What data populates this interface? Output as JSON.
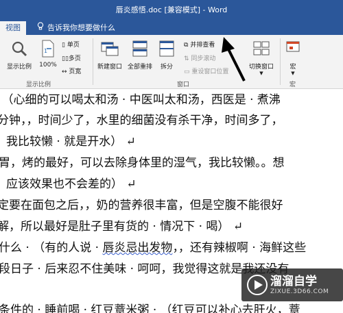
{
  "window": {
    "title": "唇炎感悟.doc [兼容模式] - Word"
  },
  "tabs": {
    "active": "视图",
    "tell_me": "告诉我你想要做什么"
  },
  "ribbon": {
    "zoom_group": {
      "zoom_label": "显示比例",
      "hundred_label": "100%",
      "one_page": "单页",
      "multi_page": "多页",
      "page_width": "页宽",
      "group_label": "显示比例"
    },
    "window_group": {
      "new_window": "新建窗口",
      "arrange_all": "全部重排",
      "split": "拆分",
      "side_by_side": "并排查看",
      "sync_scroll": "同步滚动",
      "reset_position": "重设窗口位置",
      "switch_windows": "切换窗口",
      "group_label": "窗口"
    },
    "macro_group": {
      "macros": "宏",
      "group_label": "宏"
    }
  },
  "document": {
    "lines": [
      "，（心细的可以喝太和汤 · 中医叫太和汤，西医是 · 煮沸",
      "分钟，，时间少了，水里的细菌没有杀干净，时间多了，",
      "，我比较懒 · 就是开水） ↵",
      "胃，烤的最好，可以去除身体里的湿气，我比较懒。。想",
      "，应该效果也不会差的） ↵",
      "定要在面包之后，，奶的营养很丰富，但是空腹不能很好",
      "解，所以最好是肚子里有货的 · 情况下 · 喝） ↵",
      "什么 · （有的人说 · ",
      "唇炎忌出发物",
      "，，还有辣椒啊 · 海鲜这些",
      "段日子 · 后来忍不住美味 · 呵呵，我觉得这就是我还没有",
      "条件的 · 睡前喝 · 红豆薏米粥 · （红豆可以补心去肝火，薏"
    ]
  },
  "watermark": {
    "brand": "溜溜自学",
    "url": "ZIXUE.3D66.COM"
  }
}
